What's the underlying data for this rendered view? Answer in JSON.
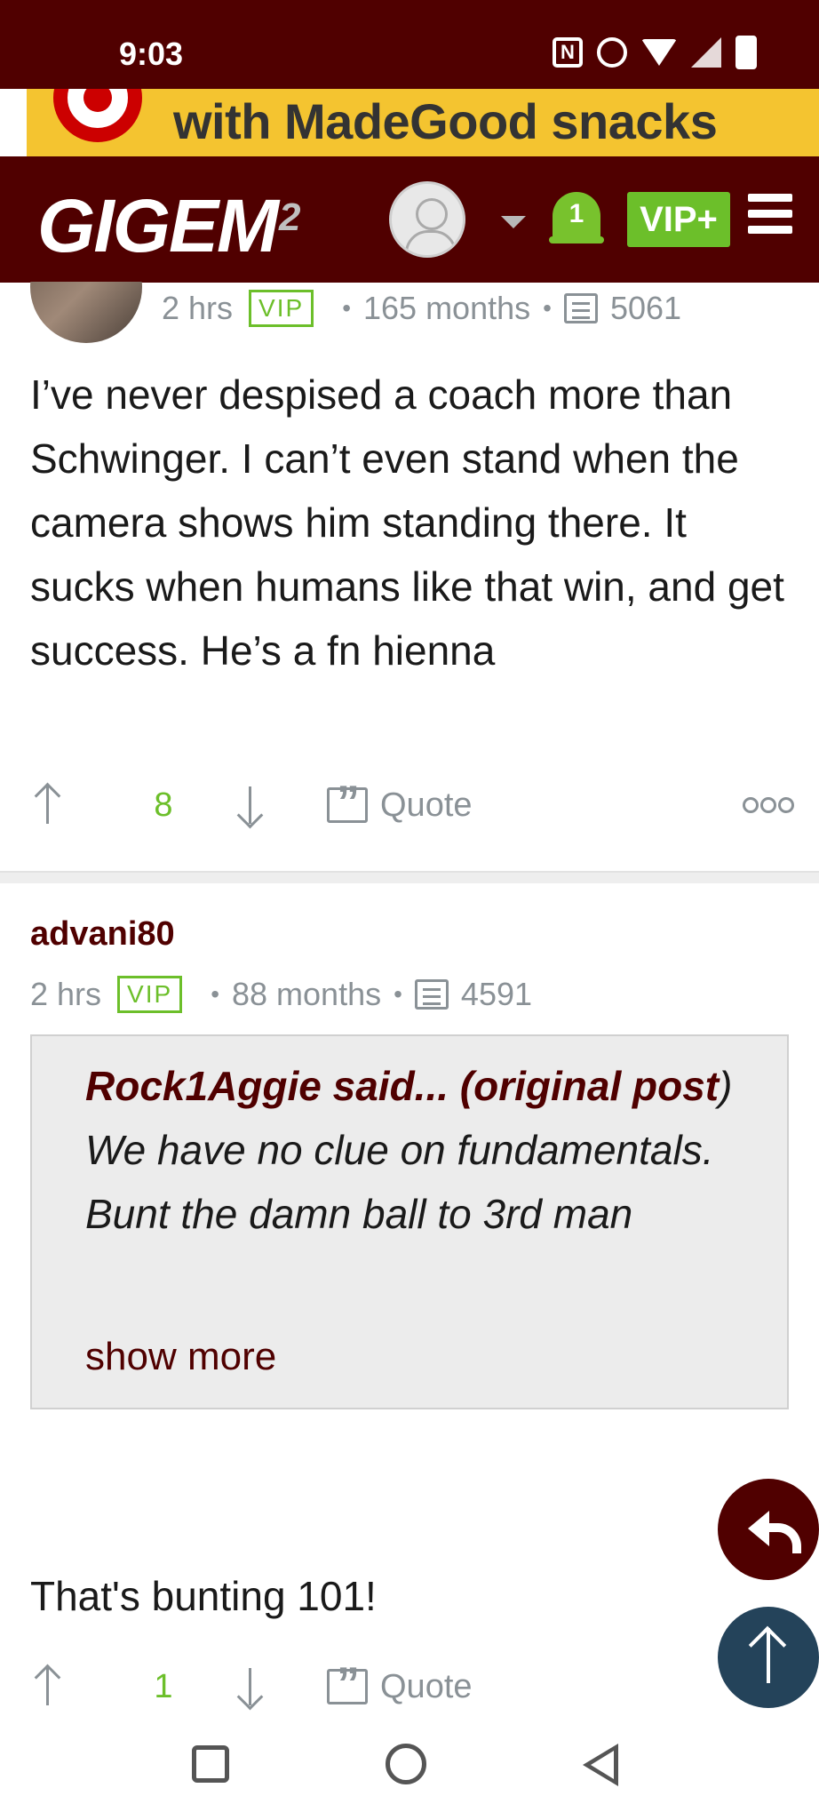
{
  "status_bar": {
    "time": "9:03",
    "icons": [
      "nfc-icon",
      "alarm-icon",
      "wifi-icon",
      "signal-icon",
      "battery-charging-icon"
    ]
  },
  "ad": {
    "text": "with MadeGood snacks",
    "brand_color": "#cc0000",
    "background": "#f4c430"
  },
  "header": {
    "logo_text": "GIGEM",
    "logo_superscript": "2",
    "notification_count": "1",
    "vip_plus_label": "VIP+",
    "colors": {
      "maroon": "#500000",
      "green": "#6cbf2a"
    }
  },
  "posts": [
    {
      "time": "2 hrs",
      "badge": "VIP",
      "tenure": "165 months",
      "post_count": "5061",
      "body": "I’ve never despised a coach more than Schwinger. I can’t even stand when the camera shows him standing there. It sucks when humans like that win, and get success. He’s a fn hienna",
      "votes": "8",
      "quote_label": "Quote"
    },
    {
      "username": "advani80",
      "time": "2 hrs",
      "badge": "VIP",
      "tenure": "88 months",
      "post_count": "4591",
      "quote": {
        "author": "Rock1Aggie said... (original post",
        "text": ") We have no clue on fundamentals. Bunt the damn ball to 3rd man",
        "show_more": "show more"
      },
      "body": "That's bunting 101!",
      "votes": "1",
      "quote_label": "Quote"
    }
  ]
}
